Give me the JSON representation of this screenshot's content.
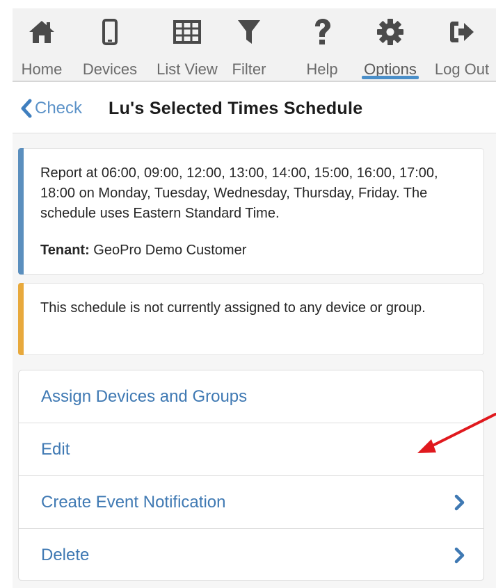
{
  "toolbar": {
    "items": [
      {
        "label": "Home",
        "icon": "home-icon"
      },
      {
        "label": "Devices",
        "icon": "mobile-device-icon"
      },
      {
        "label": "List View",
        "icon": "grid-list-icon"
      },
      {
        "label": "Filter",
        "icon": "filter-funnel-icon"
      },
      {
        "label": "Help",
        "icon": "question-mark-icon"
      },
      {
        "label": "Options",
        "icon": "gear-icon",
        "active": true
      },
      {
        "label": "Log Out",
        "icon": "sign-out-icon"
      }
    ],
    "icon_color": "#4a4a4a",
    "active_color": "#4a8fc9"
  },
  "header": {
    "back_label": "Check",
    "title": "Lu's Selected Times Schedule"
  },
  "info": {
    "description": "Report at 06:00, 09:00, 12:00, 13:00, 14:00, 15:00, 16:00, 17:00, 18:00 on Monday, Tuesday, Wednesday, Thursday, Friday. The schedule uses Eastern Standard Time.",
    "tenant_label": "Tenant:",
    "tenant_value": "GeoPro Demo Customer",
    "accent_color": "#5b8fbe"
  },
  "warning": {
    "message": "This schedule is not currently assigned to any device or group.",
    "accent_color": "#e8a93c"
  },
  "actions": [
    {
      "label": "Assign Devices and Groups",
      "chevron": false
    },
    {
      "label": "Edit",
      "chevron": false
    },
    {
      "label": "Create Event Notification",
      "chevron": true
    },
    {
      "label": "Delete",
      "chevron": true
    }
  ],
  "annotation": {
    "arrow_color": "#e0191e",
    "points_to": "Edit"
  }
}
